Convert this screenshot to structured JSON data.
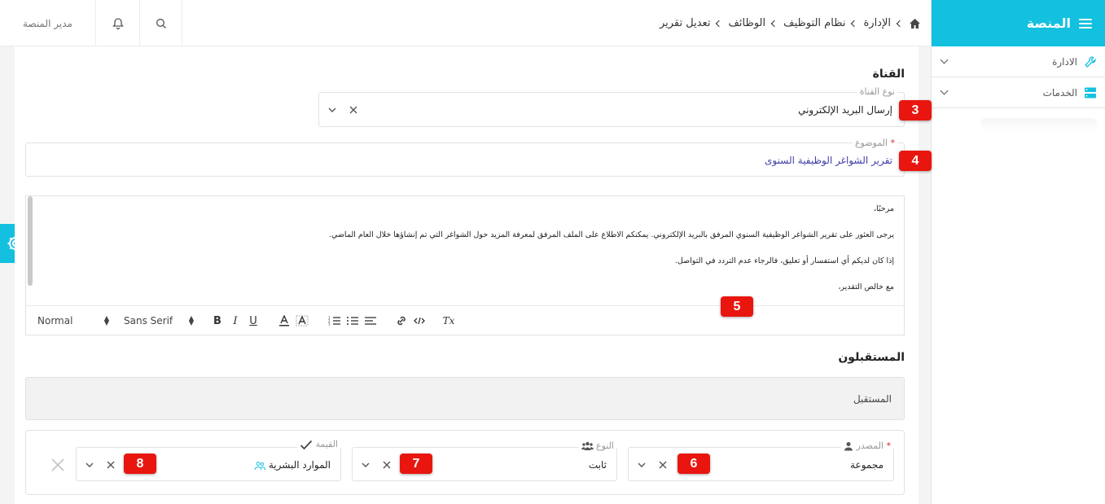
{
  "sidebar": {
    "brand": "المنصة",
    "items": [
      {
        "label": "الادارة"
      },
      {
        "label": "الخدمات"
      }
    ]
  },
  "topbar": {
    "user": "مدير المنصة",
    "breadcrumbs": [
      "الإدارة",
      "نظام التوظيف",
      "الوظائف",
      "تعديل تقرير"
    ]
  },
  "channel": {
    "section_title": "القناة",
    "type_label": "نوع القناة",
    "type_value": "إرسال البريد الإلكتروني",
    "subject_label": "الموضوع",
    "subject_required": "*",
    "subject_value": "تقرير الشواغر الوظيفية السنوى"
  },
  "editor": {
    "lines": [
      "مرحبًا،",
      "يرجى العثور على تقرير الشواغر الوظيفية السنوي المرفق بالبريد الإلكتروني. يمكنكم الاطلاع على الملف المرفق لمعرفة المزيد حول الشواغر التي تم إنشاؤها خلال العام الماضي.",
      "إذا كان لديكم أي استفسار أو تعليق، فالرجاء عدم التردد في التواصل.",
      "مع خالص التقدير،"
    ],
    "toolbar": {
      "header_select": "Normal",
      "font_select": "Sans Serif",
      "bold": "B",
      "italic": "I",
      "underline": "U",
      "clear": "Tx"
    }
  },
  "receivers": {
    "section_title": "المستقبلون",
    "receiver_label": "المستقبل",
    "rule": {
      "source_label": "المصدر",
      "source_required": "*",
      "source_value": "مجموعة",
      "type_label": "النوع",
      "type_value": "ثابت",
      "value_label": "القيمة",
      "value_value": "الموارد البشرية"
    }
  },
  "badges": [
    "3",
    "4",
    "5",
    "6",
    "7",
    "8"
  ],
  "colors": {
    "accent": "#13c0e0",
    "badge": "#e8160f",
    "subject_text": "#3f3fa8"
  }
}
